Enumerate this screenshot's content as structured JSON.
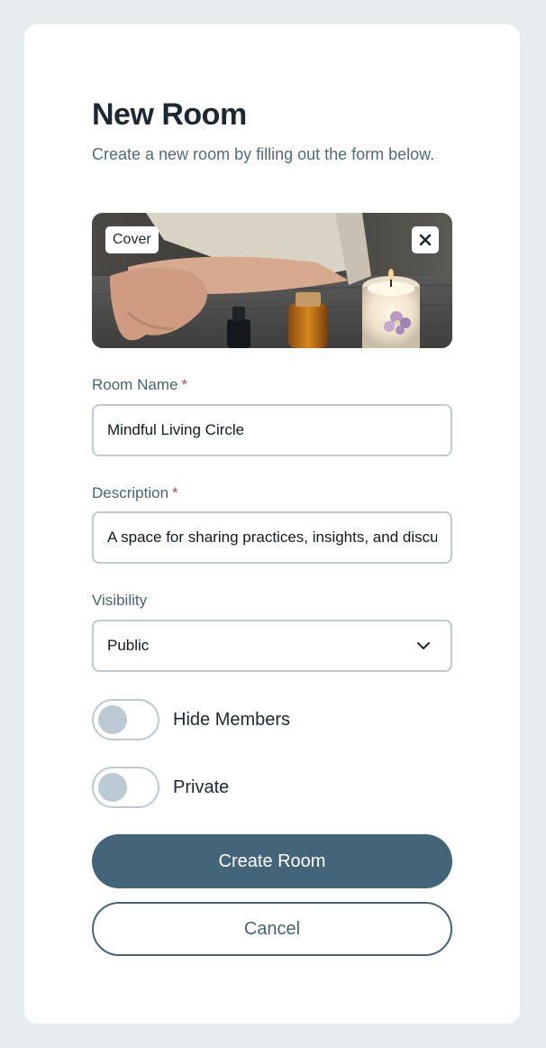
{
  "form": {
    "title": "New Room",
    "subtitle": "Create a new room by filling out the form below.",
    "cover": {
      "badge": "Cover",
      "close_icon": "close-icon"
    },
    "room_name": {
      "label": "Room Name",
      "required_mark": "*",
      "value": "Mindful Living Circle"
    },
    "description": {
      "label": "Description",
      "required_mark": "*",
      "value": "A space for sharing practices, insights, and discussions"
    },
    "visibility": {
      "label": "Visibility",
      "value": "Public",
      "icon": "chevron-down-icon"
    },
    "toggles": [
      {
        "label": "Hide Members",
        "on": false
      },
      {
        "label": "Private",
        "on": false
      }
    ],
    "buttons": {
      "create": "Create Room",
      "cancel": "Cancel"
    }
  },
  "colors": {
    "background": "#e7ecee",
    "card": "#ffffff",
    "primary": "#436479",
    "border": "#bccbd3",
    "required": "#a84a64",
    "label": "#456479"
  }
}
